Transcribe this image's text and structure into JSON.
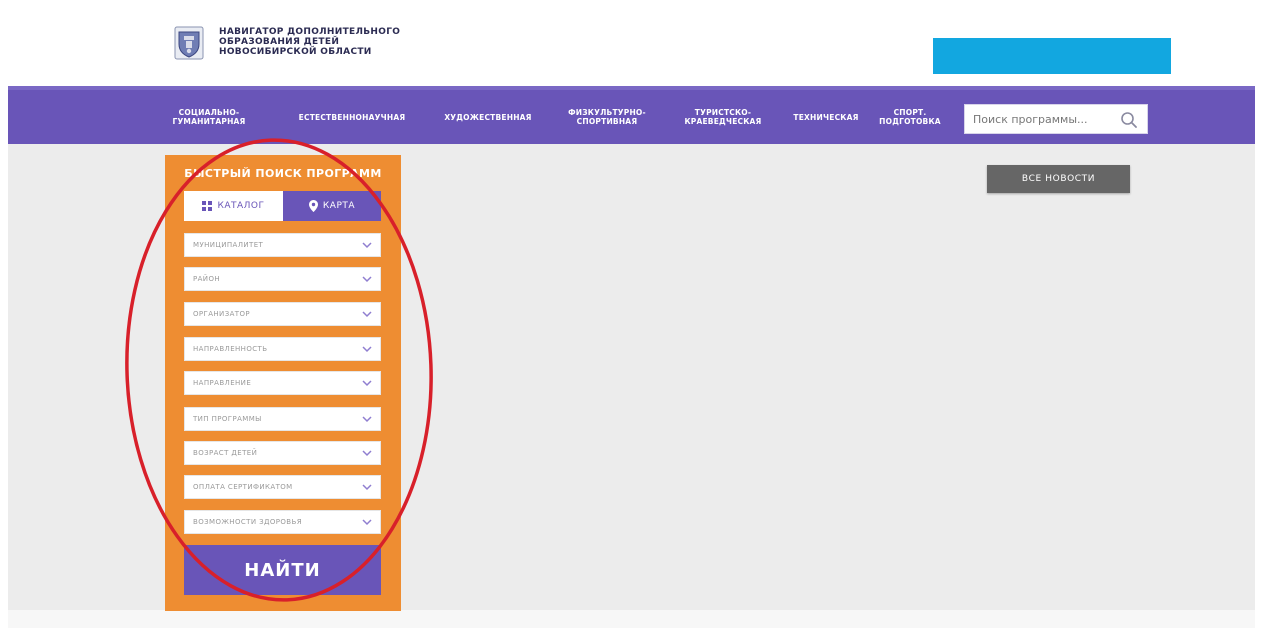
{
  "header": {
    "title_lines": [
      "НАВИГАТОР ДОПОЛНИТЕЛЬНОГО",
      "ОБРАЗОВАНИЯ ДЕТЕЙ",
      "НОВОСИБИРСКОЙ ОБЛАСТИ"
    ]
  },
  "nav": {
    "items": [
      {
        "label": "СОЦИАЛЬНО-\nГУМАНИТАРНАЯ"
      },
      {
        "label": "ЕСТЕСТВЕННОНАУЧНАЯ"
      },
      {
        "label": "ХУДОЖЕСТВЕННАЯ"
      },
      {
        "label": "ФИЗКУЛЬТУРНО-\nСПОРТИВНАЯ"
      },
      {
        "label": "ТУРИСТСКО-\nКРАЕВЕДЧЕСКАЯ"
      },
      {
        "label": "ТЕХНИЧЕСКАЯ"
      },
      {
        "label": "СПОРТ.\nПОДГОТОВКА"
      }
    ],
    "search_placeholder": "Поиск программы..."
  },
  "search_panel": {
    "title": "БЫСТРЫЙ ПОИСК ПРОГРАММ",
    "tab_catalog": "КАТАЛОГ",
    "tab_map": "КАРТА",
    "filters": [
      "МУНИЦИПАЛИТЕТ",
      "РАЙОН",
      "ОРГАНИЗАТОР",
      "НАПРАВЛЕННОСТЬ",
      "НАПРАВЛЕНИЕ",
      "ТИП ПРОГРАММЫ",
      "ВОЗРАСТ ДЕТЕЙ",
      "ОПЛАТА СЕРТИФИКАТОМ",
      "ВОЗМОЖНОСТИ ЗДОРОВЬЯ"
    ],
    "find_button": "НАЙТИ"
  },
  "news": {
    "all_news_button": "ВСЕ НОВОСТИ"
  },
  "colors": {
    "nav_bg": "#6955b8",
    "panel_bg": "#ee8d32",
    "login_box": "#12a7e0",
    "annotation": "#d8202a"
  }
}
